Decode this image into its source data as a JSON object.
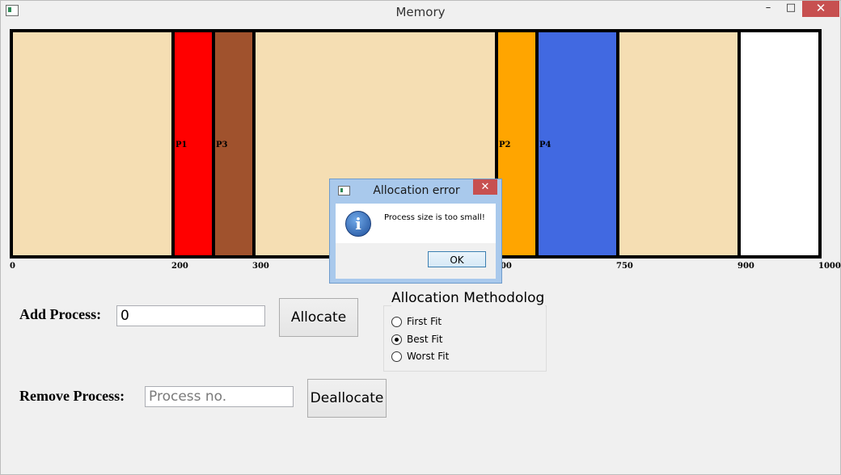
{
  "window": {
    "title": "Memory",
    "minimize_glyph": "–",
    "maximize_glyph": "□",
    "close_glyph": "✕"
  },
  "memory": {
    "total": 1000,
    "blocks": [
      {
        "start": 0,
        "end": 200,
        "label": "",
        "color": "#f5deb3"
      },
      {
        "start": 200,
        "end": 250,
        "label": "P1",
        "color": "#ff0000"
      },
      {
        "start": 250,
        "end": 300,
        "label": "P3",
        "color": "#a0522d"
      },
      {
        "start": 300,
        "end": 600,
        "label": "",
        "color": "#f5deb3"
      },
      {
        "start": 600,
        "end": 650,
        "label": "P2",
        "color": "#ffa500"
      },
      {
        "start": 650,
        "end": 750,
        "label": "P4",
        "color": "#4169e1"
      },
      {
        "start": 750,
        "end": 900,
        "label": "",
        "color": "#f5deb3"
      },
      {
        "start": 900,
        "end": 1000,
        "label": "",
        "color": "#ffffff"
      }
    ],
    "ticks": [
      "0",
      "200",
      "300",
      "600",
      "750",
      "900",
      "1000"
    ]
  },
  "add_process": {
    "label": "Add Process:",
    "value": "0",
    "button": "Allocate"
  },
  "remove_process": {
    "label": "Remove Process:",
    "placeholder": "Process no.",
    "button": "Deallocate"
  },
  "methodology": {
    "title": "Allocation Methodology",
    "options": [
      {
        "label": "First Fit",
        "checked": false
      },
      {
        "label": "Best Fit",
        "checked": true
      },
      {
        "label": "Worst Fit",
        "checked": false
      }
    ]
  },
  "dialog": {
    "title": "Allocation error",
    "close_glyph": "✕",
    "icon": "info-icon",
    "icon_glyph": "i",
    "message": "Process size is too small!",
    "ok": "OK"
  }
}
